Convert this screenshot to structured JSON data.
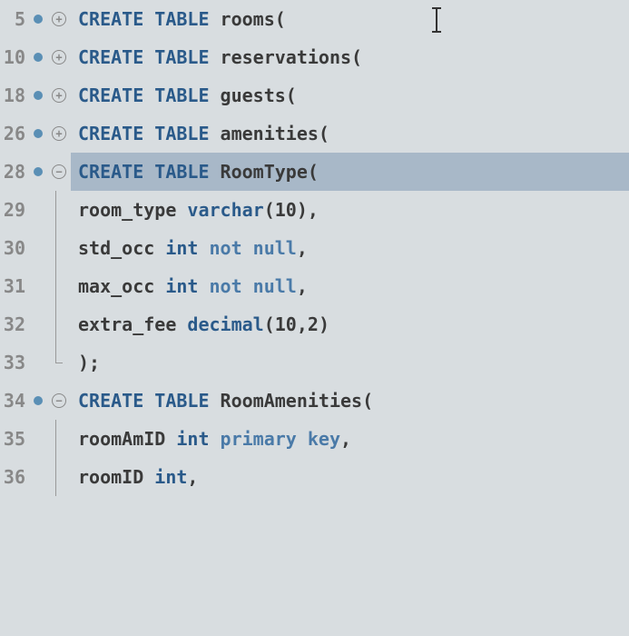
{
  "lines": [
    {
      "num": "5",
      "dot": true,
      "fold": "plus",
      "tokens": [
        [
          "kw",
          "CREATE TABLE"
        ],
        [
          "ident",
          " rooms"
        ],
        [
          "punct",
          "("
        ]
      ]
    },
    {
      "num": "10",
      "dot": true,
      "fold": "plus",
      "tokens": [
        [
          "kw",
          "CREATE TABLE"
        ],
        [
          "ident",
          " reservations"
        ],
        [
          "punct",
          "("
        ]
      ]
    },
    {
      "num": "18",
      "dot": true,
      "fold": "plus",
      "tokens": [
        [
          "kw",
          "CREATE TABLE"
        ],
        [
          "ident",
          " guests"
        ],
        [
          "punct",
          "("
        ]
      ]
    },
    {
      "num": "26",
      "dot": true,
      "fold": "plus",
      "tokens": [
        [
          "kw",
          "CREATE TABLE"
        ],
        [
          "ident",
          " amenities"
        ],
        [
          "punct",
          "("
        ]
      ]
    },
    {
      "num": "28",
      "dot": true,
      "fold": "minus",
      "highlight": true,
      "tokens": [
        [
          "kw",
          "CREATE TABLE"
        ],
        [
          "ident",
          " RoomType"
        ],
        [
          "punct",
          "("
        ]
      ]
    },
    {
      "num": "29",
      "guide": true,
      "tokens": [
        [
          "ident",
          "room_type "
        ],
        [
          "type",
          "varchar"
        ],
        [
          "punct",
          "("
        ],
        [
          "num",
          "10"
        ],
        [
          "punct",
          "),"
        ]
      ]
    },
    {
      "num": "30",
      "guide": true,
      "tokens": [
        [
          "ident",
          "std_occ "
        ],
        [
          "type",
          "int"
        ],
        [
          "constraint",
          " not null"
        ],
        [
          "punct",
          ","
        ]
      ]
    },
    {
      "num": "31",
      "guide": true,
      "tokens": [
        [
          "ident",
          "max_occ "
        ],
        [
          "type",
          "int"
        ],
        [
          "constraint",
          " not null"
        ],
        [
          "punct",
          ","
        ]
      ]
    },
    {
      "num": "32",
      "guide": true,
      "tokens": [
        [
          "ident",
          "extra_fee "
        ],
        [
          "type",
          "decimal"
        ],
        [
          "punct",
          "("
        ],
        [
          "num",
          "10"
        ],
        [
          "punct",
          ","
        ],
        [
          "num",
          "2"
        ],
        [
          "punct",
          ")"
        ]
      ]
    },
    {
      "num": "33",
      "guide": "end",
      "tokens": [
        [
          "punct",
          ");"
        ]
      ]
    },
    {
      "num": "34",
      "dot": true,
      "fold": "minus",
      "tokens": [
        [
          "kw",
          "CREATE TABLE"
        ],
        [
          "ident",
          " RoomAmenities"
        ],
        [
          "punct",
          "("
        ]
      ]
    },
    {
      "num": "35",
      "guide": true,
      "tokens": [
        [
          "ident",
          "roomAmID "
        ],
        [
          "type",
          "int"
        ],
        [
          "constraint",
          " primary key"
        ],
        [
          "punct",
          ","
        ]
      ]
    },
    {
      "num": "36",
      "guide": true,
      "tokens": [
        [
          "ident",
          "roomID "
        ],
        [
          "type",
          "int"
        ],
        [
          "punct",
          ","
        ]
      ]
    }
  ],
  "fold_plus": "+",
  "fold_minus": "−"
}
